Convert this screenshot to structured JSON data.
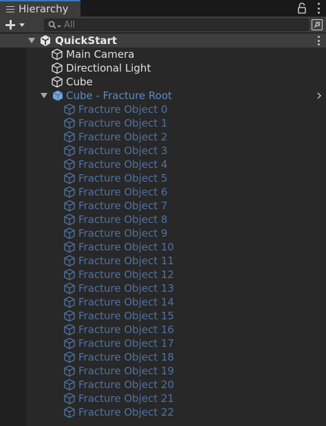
{
  "window": {
    "tab_label": "Hierarchy",
    "tab_icon": "list-icon",
    "lock_icon": "lock-icon",
    "menu_icon": "kebab-menu-icon"
  },
  "toolbar": {
    "create_icon": "plus-icon",
    "search_placeholder": "All",
    "search_value": "",
    "scene_picker_icon": "scene-picker-icon"
  },
  "colors": {
    "panel_bg": "#282828",
    "tab_accent": "#3a79bb",
    "prefab_blue": "#5b8ac8",
    "prefab_blue_dim": "#4f72a3"
  },
  "hierarchy": {
    "scene": {
      "label": "QuickStart",
      "icon": "unity-logo-icon",
      "expanded": true
    },
    "objects": [
      {
        "label": "Main Camera",
        "icon": "gameobject-cube-icon"
      },
      {
        "label": "Directional Light",
        "icon": "gameobject-cube-icon"
      },
      {
        "label": "Cube",
        "icon": "gameobject-cube-icon"
      }
    ],
    "prefab_root": {
      "label": "Cube - Fracture Root",
      "icon": "prefab-cube-icon",
      "expanded": true
    },
    "children": [
      "Fracture Object 0",
      "Fracture Object 1",
      "Fracture Object 2",
      "Fracture Object 3",
      "Fracture Object 4",
      "Fracture Object 5",
      "Fracture Object 6",
      "Fracture Object 7",
      "Fracture Object 8",
      "Fracture Object 9",
      "Fracture Object 10",
      "Fracture Object 11",
      "Fracture Object 12",
      "Fracture Object 13",
      "Fracture Object 14",
      "Fracture Object 15",
      "Fracture Object 16",
      "Fracture Object 17",
      "Fracture Object 18",
      "Fracture Object 19",
      "Fracture Object 20",
      "Fracture Object 21",
      "Fracture Object 22"
    ]
  }
}
